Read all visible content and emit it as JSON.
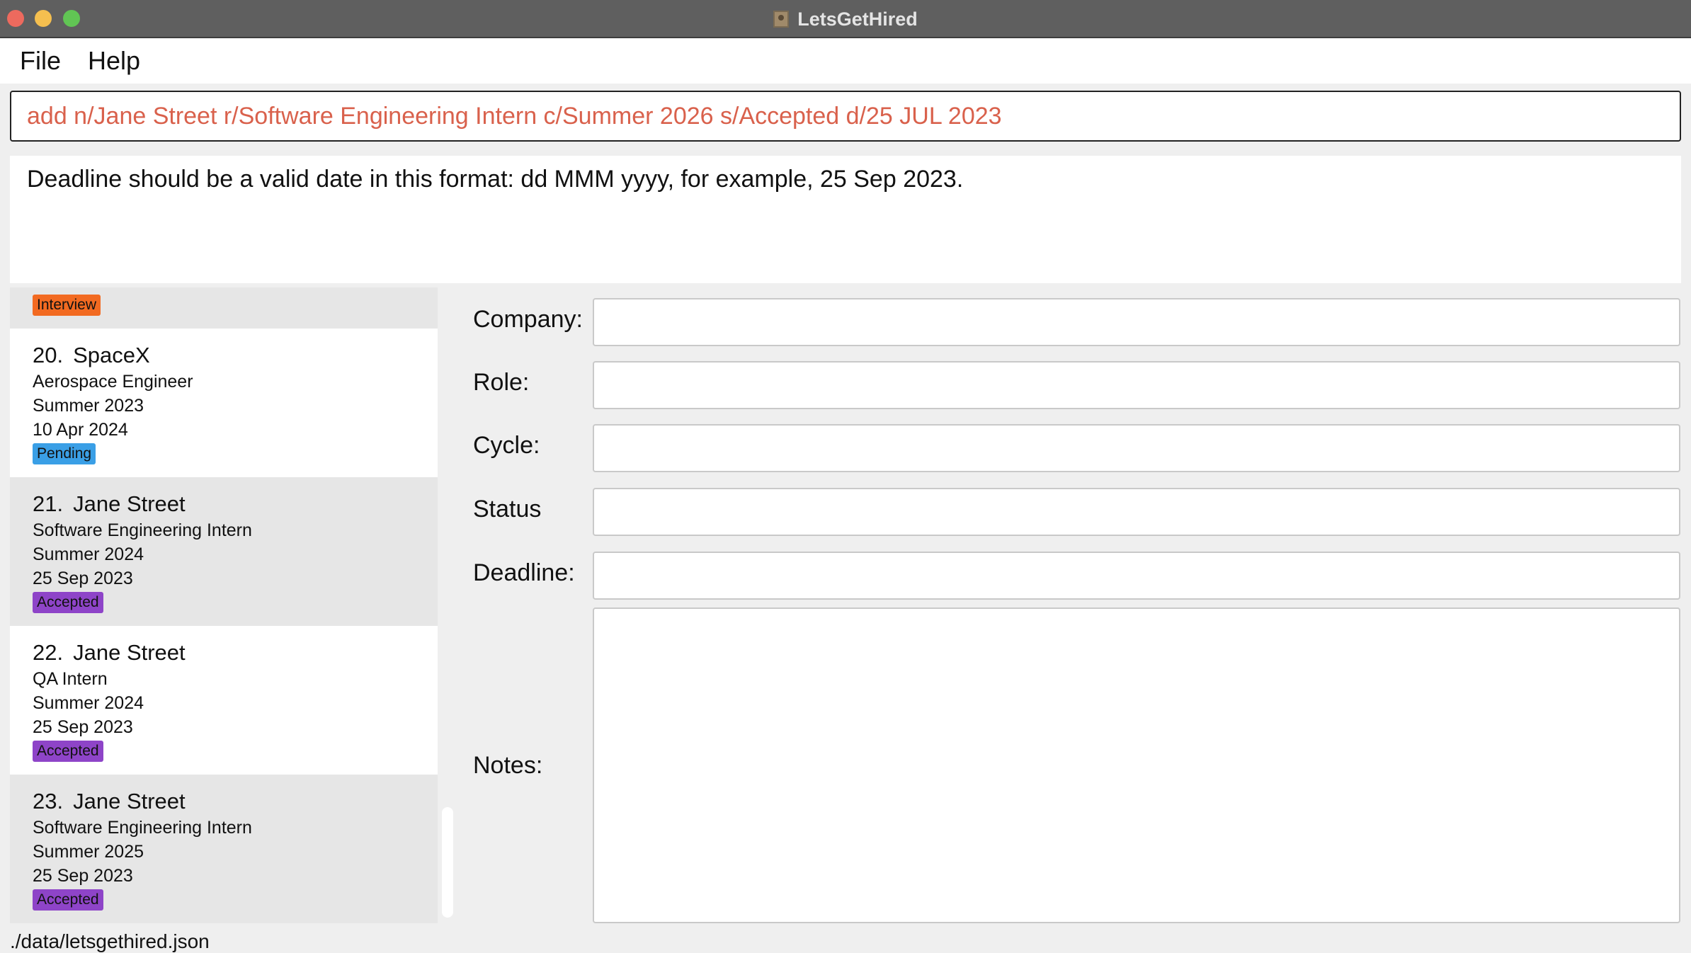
{
  "window": {
    "title": "LetsGetHired",
    "icon": "app-icon"
  },
  "menu": {
    "file": "File",
    "help": "Help"
  },
  "command": {
    "value": "add n/Jane Street r/Software Engineering Intern c/Summer 2026 s/Accepted d/25 JUL 2023"
  },
  "result": {
    "message": "Deadline should be a valid date in this format: dd MMM yyyy, for example, 25 Sep 2023."
  },
  "list": {
    "partial_card": {
      "badge": "Interview",
      "badge_color": "#f26a21"
    },
    "cards": [
      {
        "index": "20.",
        "company": "SpaceX",
        "role": "Aerospace Engineer",
        "cycle": "Summer 2023",
        "deadline": "10 Apr 2024",
        "status": "Pending",
        "status_color": "#3a9fe6"
      },
      {
        "index": "21.",
        "company": "Jane Street",
        "role": "Software Engineering Intern",
        "cycle": "Summer 2024",
        "deadline": "25 Sep 2023",
        "status": "Accepted",
        "status_color": "#8e44c8"
      },
      {
        "index": "22.",
        "company": "Jane Street",
        "role": "QA Intern",
        "cycle": "Summer 2024",
        "deadline": "25 Sep 2023",
        "status": "Accepted",
        "status_color": "#8e44c8"
      },
      {
        "index": "23.",
        "company": "Jane Street",
        "role": "Software Engineering Intern",
        "cycle": "Summer 2025",
        "deadline": "25 Sep 2023",
        "status": "Accepted",
        "status_color": "#8e44c8"
      }
    ]
  },
  "detail": {
    "company_label": "Company:",
    "role_label": "Role:",
    "cycle_label": "Cycle:",
    "status_label": "Status",
    "deadline_label": "Deadline:",
    "notes_label": "Notes:",
    "company_value": "",
    "role_value": "",
    "cycle_value": "",
    "status_value": "",
    "deadline_value": "",
    "notes_value": ""
  },
  "status_bar": {
    "path": "./data/letsgethired.json"
  }
}
